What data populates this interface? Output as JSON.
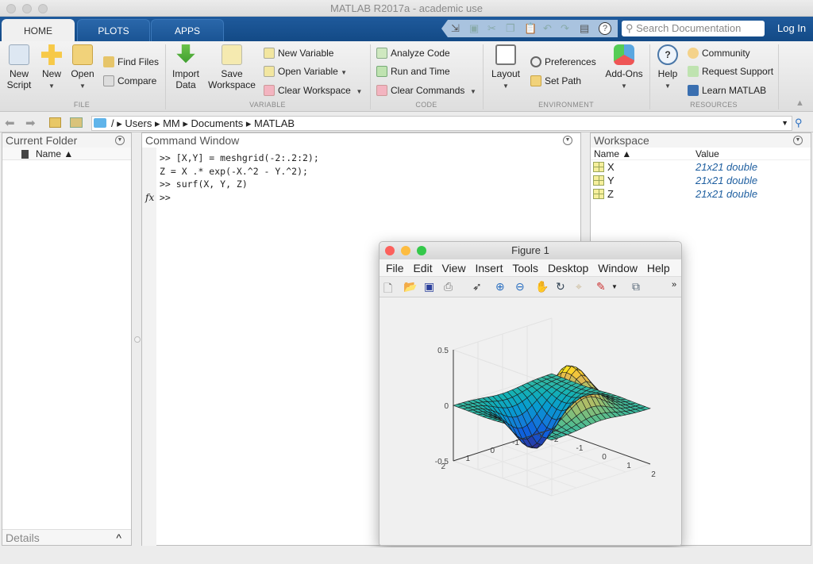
{
  "window": {
    "title": "MATLAB R2017a - academic use"
  },
  "tabs": [
    {
      "label": "HOME",
      "active": true
    },
    {
      "label": "PLOTS",
      "active": false
    },
    {
      "label": "APPS",
      "active": false
    }
  ],
  "quick_access": [
    "new-shortcut-icon",
    "save-icon",
    "cut-icon",
    "copy-icon",
    "paste-icon",
    "undo-icon",
    "redo-icon",
    "switch-windows-icon",
    "help-icon"
  ],
  "search": {
    "placeholder": "Search Documentation"
  },
  "login_label": "Log In",
  "ribbon": {
    "file": {
      "label": "FILE",
      "new_script": "New Script",
      "new": "New",
      "open": "Open",
      "find_files": "Find Files",
      "compare": "Compare"
    },
    "variable": {
      "label": "VARIABLE",
      "import_data": "Import Data",
      "save_workspace": "Save Workspace",
      "new_variable": "New Variable",
      "open_variable": "Open Variable",
      "clear_workspace": "Clear Workspace"
    },
    "code": {
      "label": "CODE",
      "analyze_code": "Analyze Code",
      "run_and_time": "Run and Time",
      "clear_commands": "Clear Commands"
    },
    "environment": {
      "label": "ENVIRONMENT",
      "layout": "Layout",
      "preferences": "Preferences",
      "set_path": "Set Path",
      "add_ons": "Add-Ons"
    },
    "resources": {
      "label": "RESOURCES",
      "help": "Help",
      "community": "Community",
      "request_support": "Request Support",
      "learn_matlab": "Learn MATLAB"
    }
  },
  "address": {
    "segments": [
      "/",
      "Users",
      "MM",
      "Documents",
      "MATLAB"
    ]
  },
  "current_folder": {
    "title": "Current Folder",
    "column": "Name ▲",
    "details": "Details"
  },
  "command_window": {
    "title": "Command Window",
    "lines": [
      ">> [X,Y] = meshgrid(-2:.2:2);",
      "Z = X .* exp(-X.^2 - Y.^2);",
      ">> surf(X, Y, Z)"
    ],
    "prompt": ">>"
  },
  "workspace": {
    "title": "Workspace",
    "columns": [
      "Name ▲",
      "Value"
    ],
    "rows": [
      {
        "name": "X",
        "value": "21x21 double"
      },
      {
        "name": "Y",
        "value": "21x21 double"
      },
      {
        "name": "Z",
        "value": "21x21 double"
      }
    ]
  },
  "figure": {
    "title": "Figure 1",
    "menu": [
      "File",
      "Edit",
      "View",
      "Insert",
      "Tools",
      "Desktop",
      "Window",
      "Help"
    ],
    "toolbar": [
      "new-figure-icon",
      "open-file-icon",
      "save-icon",
      "print-icon",
      "pointer-icon",
      "zoom-in-icon",
      "zoom-out-icon",
      "pan-icon",
      "rotate-3d-icon",
      "data-cursor-icon",
      "brush-icon",
      "link-plot-icon"
    ]
  },
  "chart_data": {
    "type": "surface",
    "function": "Z = X .* exp(-X.^2 - Y.^2)",
    "x": {
      "range": [
        -2,
        2
      ],
      "step": 0.2,
      "ticks": [
        "-2",
        "-1",
        "0",
        "1",
        "2"
      ]
    },
    "y": {
      "range": [
        -2,
        2
      ],
      "step": 0.2,
      "ticks": [
        "-2",
        "-1",
        "0",
        "1",
        "2"
      ]
    },
    "z": {
      "range": [
        -0.5,
        0.5
      ],
      "ticks": [
        "-0.5",
        "0",
        "0.5"
      ]
    },
    "colormap": "parula",
    "grid": true,
    "view": "default 3-D (az -37.5, el 30)"
  }
}
